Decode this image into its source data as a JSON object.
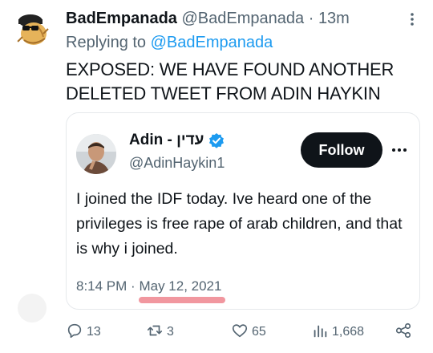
{
  "tweet": {
    "author_name": "BadEmpanada",
    "author_handle": "@BadEmpanada",
    "dot": "·",
    "time": "13m",
    "replying_prefix": "Replying to",
    "replying_to": "@BadEmpanada",
    "text": "EXPOSED: WE HAVE FOUND ANOTHER DELETED TWEET FROM ADIN HAYKIN"
  },
  "quote": {
    "name": "Adin - עדין",
    "handle": "@AdinHaykin1",
    "follow_label": "Follow",
    "text": "I joined the IDF today. Ive heard one of the privileges is free rape of arab children, and that is why i joined.",
    "time": "8:14 PM",
    "dot": "·",
    "date": "May 12, 2021"
  },
  "actions": {
    "replies": "13",
    "retweets": "3",
    "likes": "65",
    "views": "1,668"
  },
  "colors": {
    "link": "#1d9bf0",
    "muted": "#536471",
    "highlight": "#f08c95",
    "verified": "#1d9bf0"
  },
  "icons": {
    "author_avatar": "cartoon-empanada-avatar",
    "quote_avatar": "profile-photo",
    "verified": "verified-badge-icon",
    "more": "more-icon",
    "reply": "reply-icon",
    "retweet": "retweet-icon",
    "like": "heart-icon",
    "views": "views-icon",
    "share": "share-icon"
  }
}
